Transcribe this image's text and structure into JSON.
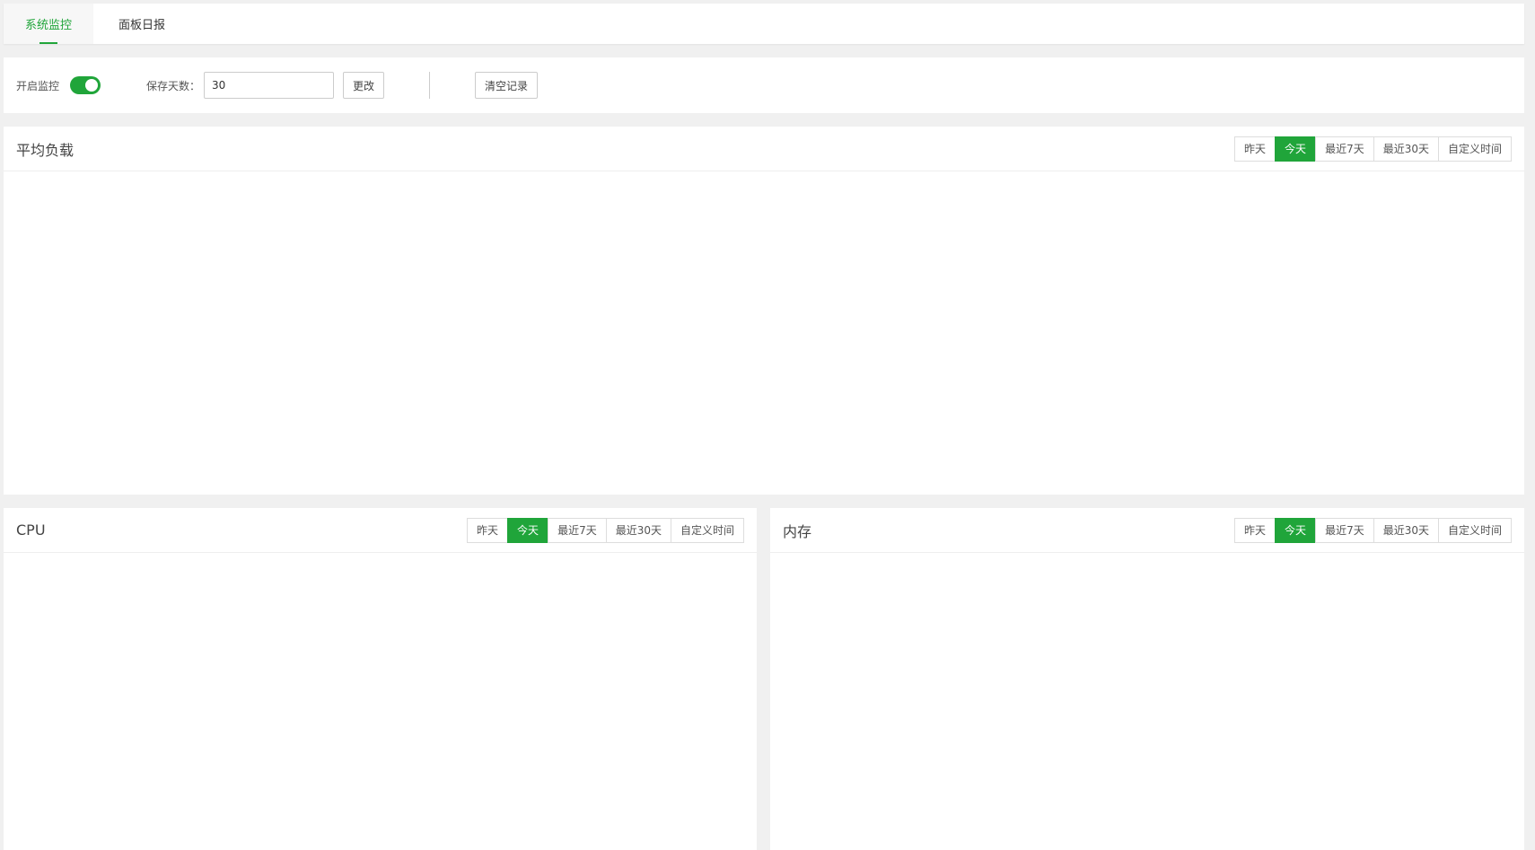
{
  "tabs": [
    {
      "label": "系统监控",
      "active": true
    },
    {
      "label": "面板日报",
      "active": false
    }
  ],
  "controls": {
    "monitor_label": "开启监控",
    "monitor_enabled": true,
    "days_label": "保存天数：",
    "days_value": "30",
    "change_label": "更改",
    "clear_label": "清空记录"
  },
  "range_options": [
    "昨天",
    "今天",
    "最近7天",
    "最近30天",
    "自定义时间"
  ],
  "selected_range": "今天",
  "panels": {
    "load": {
      "title": "平均负载"
    },
    "cpu": {
      "title": "CPU"
    },
    "memory": {
      "title": "内存"
    }
  },
  "colors": {
    "accent": "#20a53a"
  }
}
